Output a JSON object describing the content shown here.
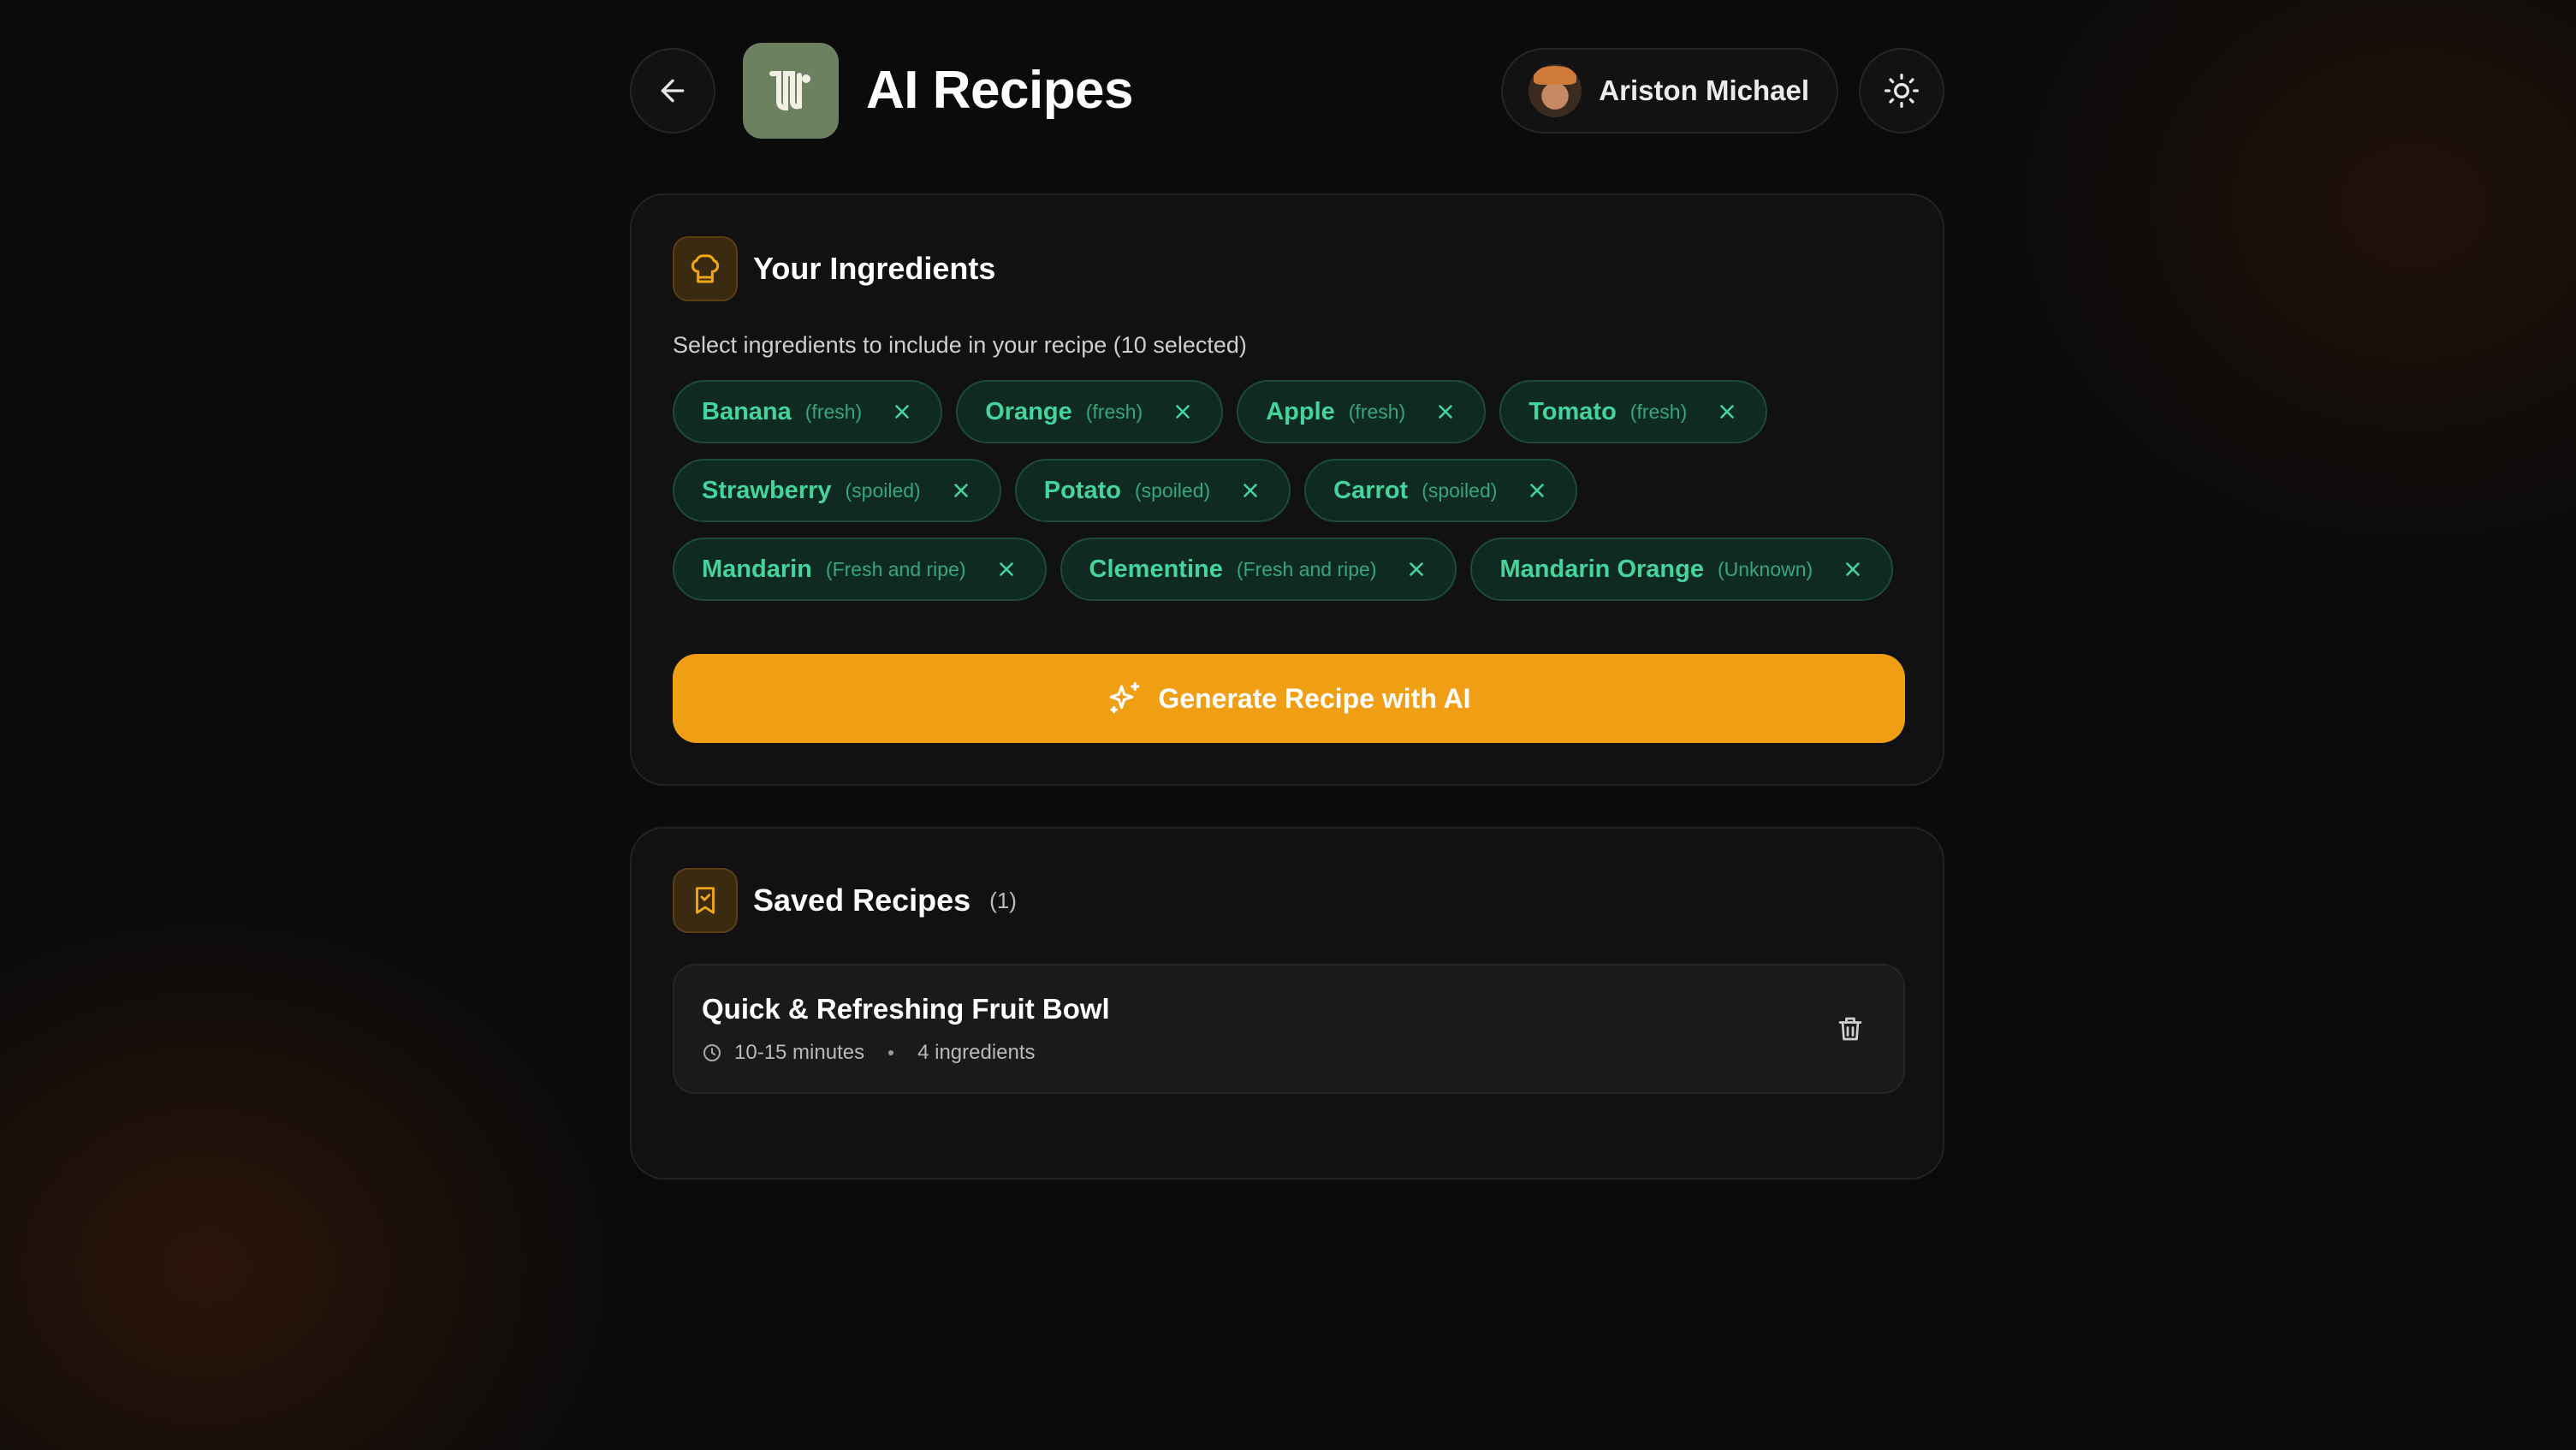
{
  "header": {
    "title": "AI Recipes",
    "logo_letter": "W",
    "user_name": "Ariston Michael"
  },
  "ingredients": {
    "title": "Your Ingredients",
    "subtitle": "Select ingredients to include in your recipe (10 selected)",
    "rows": [
      [
        {
          "name": "Banana",
          "state": "(fresh)"
        },
        {
          "name": "Orange",
          "state": "(fresh)"
        },
        {
          "name": "Apple",
          "state": "(fresh)"
        },
        {
          "name": "Tomato",
          "state": "(fresh)"
        }
      ],
      [
        {
          "name": "Strawberry",
          "state": "(spoiled)"
        },
        {
          "name": "Potato",
          "state": "(spoiled)"
        },
        {
          "name": "Carrot",
          "state": "(spoiled)"
        }
      ],
      [
        {
          "name": "Mandarin",
          "state": "(Fresh and ripe)"
        },
        {
          "name": "Clementine",
          "state": "(Fresh and ripe)"
        },
        {
          "name": "Mandarin Orange",
          "state": "(Unknown)"
        }
      ]
    ],
    "generate_label": "Generate Recipe with AI"
  },
  "saved": {
    "title": "Saved Recipes",
    "count": "(1)",
    "recipes": [
      {
        "title": "Quick & Refreshing Fruit Bowl",
        "time": "10-15 minutes",
        "ingredients": "4 ingredients"
      }
    ]
  },
  "colors": {
    "accent": "#f09e14",
    "chip_text": "#45d49c",
    "chip_bg": "#0f2a22",
    "logo_bg": "#6b8160"
  },
  "icons": [
    "arrow-left-icon",
    "sun-icon",
    "chef-hat-icon",
    "x-icon",
    "sparkles-icon",
    "bookmark-icon",
    "clock-icon",
    "trash-icon"
  ]
}
